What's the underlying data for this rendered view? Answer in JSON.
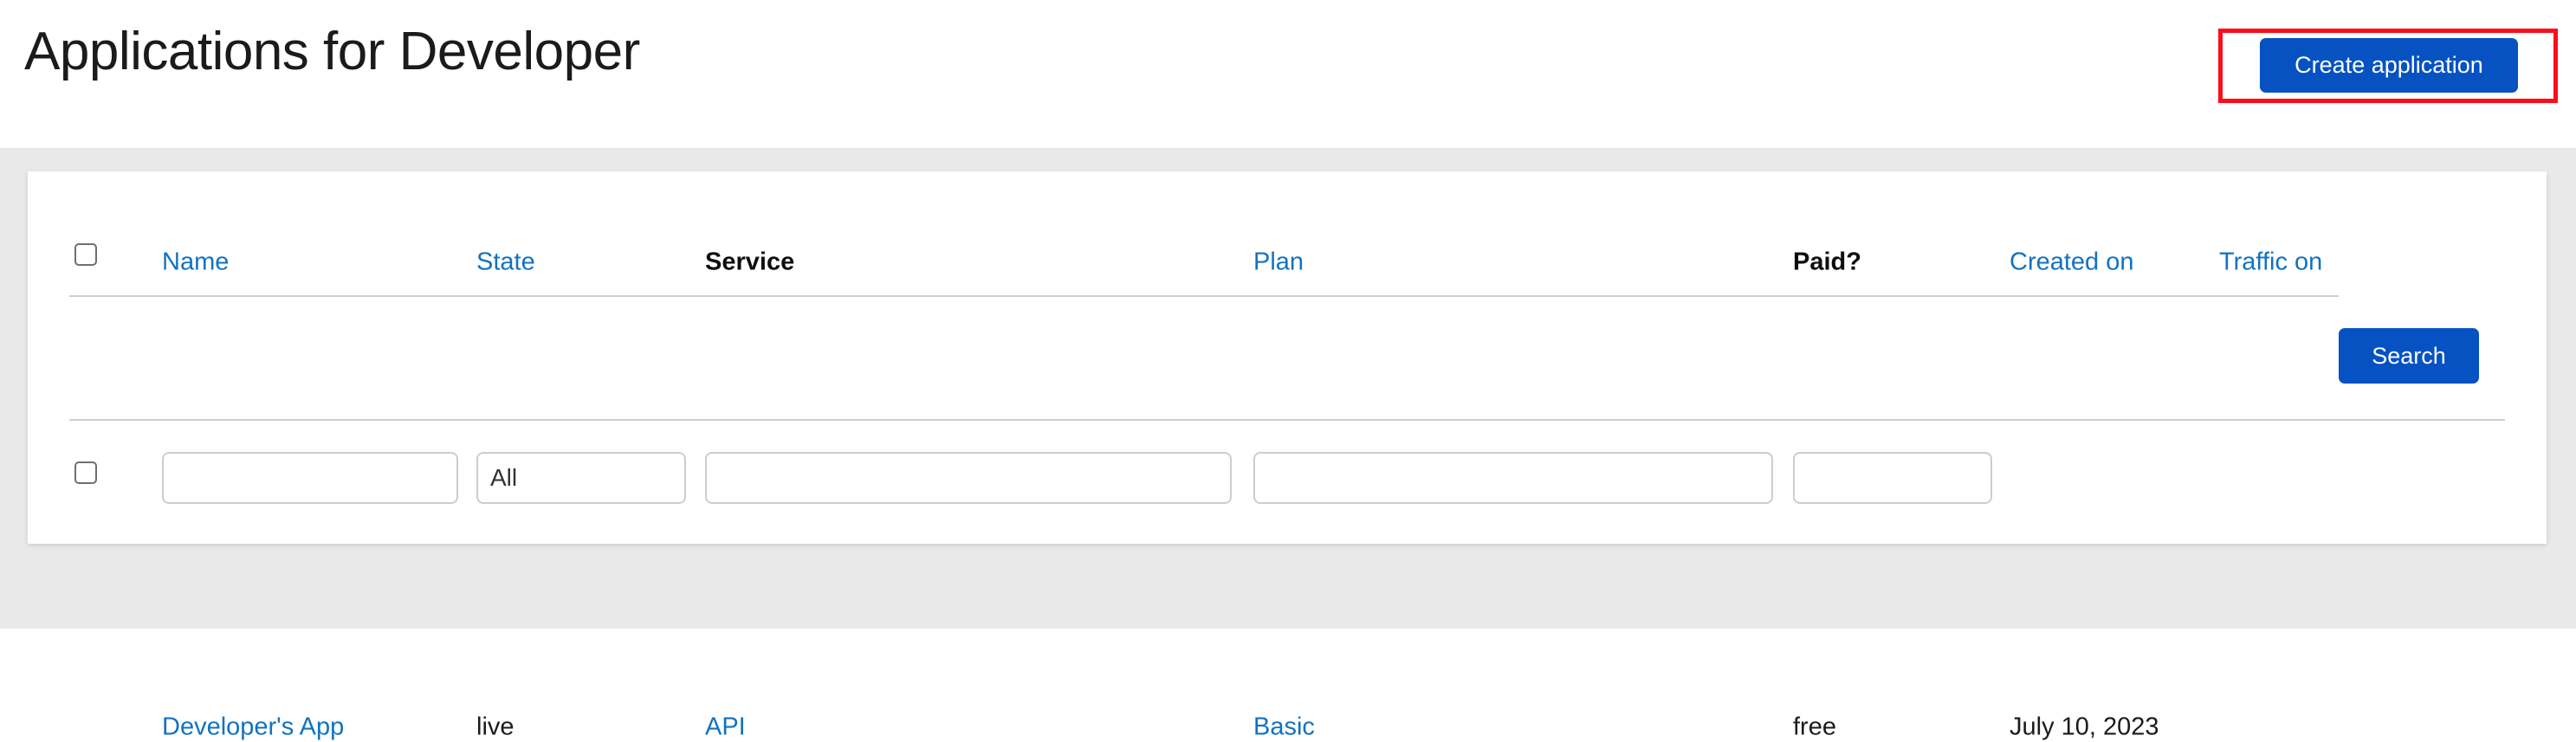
{
  "page": {
    "title": "Applications for Developer",
    "background_color": "#e9e9e9",
    "card_background": "#ffffff"
  },
  "colors": {
    "primary_button": "#0652c3",
    "link": "#1272c0",
    "annotation": "#fc0d1b",
    "text": "#1b1b1b",
    "rule": "#cfcfcf",
    "input_border": "#cdcdcd"
  },
  "header": {
    "create_button_label": "Create application"
  },
  "table": {
    "columns": [
      {
        "key": "name",
        "label": "Name",
        "type": "link",
        "sorted": false
      },
      {
        "key": "state",
        "label": "State",
        "type": "link",
        "sorted": false
      },
      {
        "key": "service",
        "label": "Service",
        "type": "active",
        "sorted": true
      },
      {
        "key": "plan",
        "label": "Plan",
        "type": "link",
        "sorted": false
      },
      {
        "key": "paid",
        "label": "Paid?",
        "type": "active",
        "sorted": true
      },
      {
        "key": "created_on",
        "label": "Created on",
        "type": "link",
        "sorted": false
      },
      {
        "key": "traffic_on",
        "label": "Traffic on",
        "type": "link",
        "sorted": false
      }
    ],
    "filters": {
      "name_value": "",
      "name_placeholder": "",
      "state_value": "All",
      "service_value": "",
      "service_placeholder": "",
      "plan_value": "",
      "plan_placeholder": "",
      "paid_value": "",
      "paid_placeholder": "",
      "search_button_label": "Search"
    },
    "rows": [
      {
        "name": "Developer's App",
        "state": "live",
        "service": "API",
        "plan": "Basic",
        "paid": "free",
        "created_on": "July 10, 2023",
        "traffic_on": ""
      }
    ]
  },
  "icons": {
    "select_all_checkbox": "checkbox-icon",
    "row_checkbox": "checkbox-icon"
  }
}
